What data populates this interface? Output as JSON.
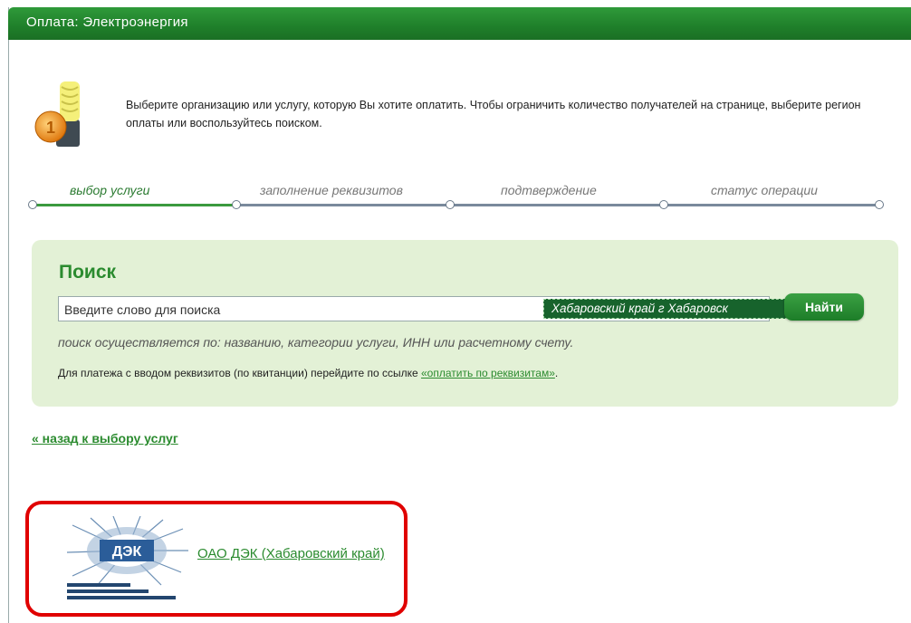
{
  "header": {
    "title": "Оплата: Электроэнергия"
  },
  "intro": {
    "text": "Выберите организацию или услугу, которую Вы хотите оплатить. Чтобы ограничить количество получателей на странице, выберите регион оплаты или воспользуйтесь поиском."
  },
  "steps": [
    {
      "label": "выбор услуги",
      "active": true
    },
    {
      "label": "заполнение реквизитов",
      "active": false
    },
    {
      "label": "подтверждение",
      "active": false
    },
    {
      "label": "статус операции",
      "active": false
    }
  ],
  "search": {
    "title": "Поиск",
    "placeholder": "Введите слово для поиска",
    "region": "Хабаровский край г Хабаровск",
    "button_label": "Найти",
    "hint": "поиск осуществляется по: названию, категории услуги, ИНН или расчетному счету.",
    "requisites_prefix": "Для платежа с вводом реквизитов (по квитанции) перейдите по ссылке ",
    "requisites_link": "«оплатить по реквизитам»",
    "requisites_suffix": "."
  },
  "back_link": "« назад к выбору услуг",
  "provider": {
    "name": "ОАО ДЭК (Хабаровский край)",
    "logo_text": "ДЭК"
  },
  "colors": {
    "brand_green": "#2b8b2f",
    "header_green": "#1f7f2a",
    "search_bg": "#e3f1d6",
    "highlight_red": "#e00000"
  }
}
